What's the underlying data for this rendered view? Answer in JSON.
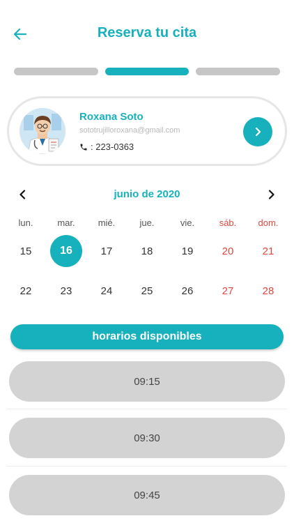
{
  "header": {
    "title": "Reserva tu cita",
    "back_icon": "arrow-left-icon"
  },
  "steps": {
    "count": 3,
    "active_index": 1
  },
  "doctor": {
    "name": "Roxana Soto",
    "email": "sototrujilloroxana@gmail.com",
    "phone": ": 223-0363",
    "avatar_icon": "doctor-avatar-icon",
    "action_icon": "chevron-right-icon"
  },
  "calendar": {
    "month_label": "junio de 2020",
    "weekdays": [
      "lun.",
      "mar.",
      "mié.",
      "jue.",
      "vie.",
      "sáb.",
      "dom."
    ],
    "weeks": [
      [
        "15",
        "16",
        "17",
        "18",
        "19",
        "20",
        "21"
      ],
      [
        "22",
        "23",
        "24",
        "25",
        "26",
        "27",
        "28"
      ]
    ],
    "selected_day": "16"
  },
  "slots": {
    "title": "horarios disponibles",
    "times": [
      "09:15",
      "09:30",
      "09:45"
    ]
  },
  "colors": {
    "accent": "#17b1bd",
    "weekend": "#e0483e",
    "slot_bg": "#d3d3d3",
    "inactive_step": "#c6c6c6"
  }
}
